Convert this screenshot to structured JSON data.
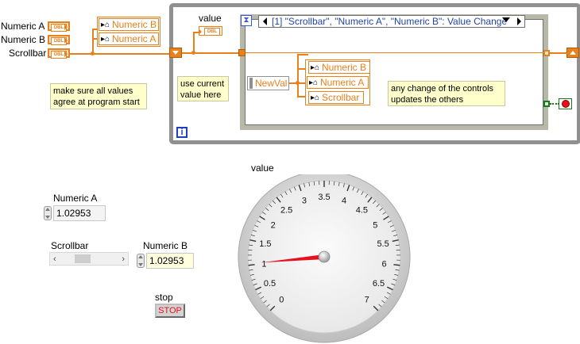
{
  "block_diagram": {
    "terminals": {
      "numeric_a_label": "Numeric A",
      "numeric_b_label": "Numeric B",
      "scrollbar_label": "Scrollbar",
      "dbl_text": "DBL"
    },
    "local_variables": {
      "left_numeric_b": "Numeric B",
      "left_numeric_a": "Numeric A",
      "inner_numeric_b": "Numeric B",
      "inner_numeric_a": "Numeric A",
      "inner_scrollbar": "Scrollbar"
    },
    "value_indicator_label": "value",
    "event_selector": "[1] \"Scrollbar\", \"Numeric A\", \"Numeric B\": Value Change",
    "newval_label": "NewVal",
    "iteration_label": "i",
    "comments": {
      "program_start_line1": "make sure all values",
      "program_start_line2": "agree at program start",
      "use_current_line1": "use current",
      "use_current_line2": "value here",
      "any_change_line1": "any change of the controls",
      "any_change_line2": "updates the others"
    }
  },
  "front_panel": {
    "numeric_a": {
      "label": "Numeric A",
      "value": "1.02953"
    },
    "scrollbar": {
      "label": "Scrollbar",
      "position": 0.3
    },
    "numeric_b": {
      "label": "Numeric B",
      "value": "1.02953"
    },
    "stop": {
      "label": "stop",
      "button_text": "STOP"
    },
    "gauge": {
      "label": "value",
      "ticks": [
        "0",
        "0.5",
        "1",
        "1.5",
        "2",
        "2.5",
        "3",
        "3.5",
        "4",
        "4.5",
        "5",
        "5.5",
        "6",
        "6.5",
        "7"
      ],
      "min": 0,
      "max": 7,
      "value": 1.02953,
      "needle_color": "#e8101c"
    }
  },
  "colors": {
    "wire_orange": "#e8801c",
    "loop_gray": "#909090",
    "note_yellow": "#ffffcc",
    "event_frame": "#b8b8a8"
  }
}
